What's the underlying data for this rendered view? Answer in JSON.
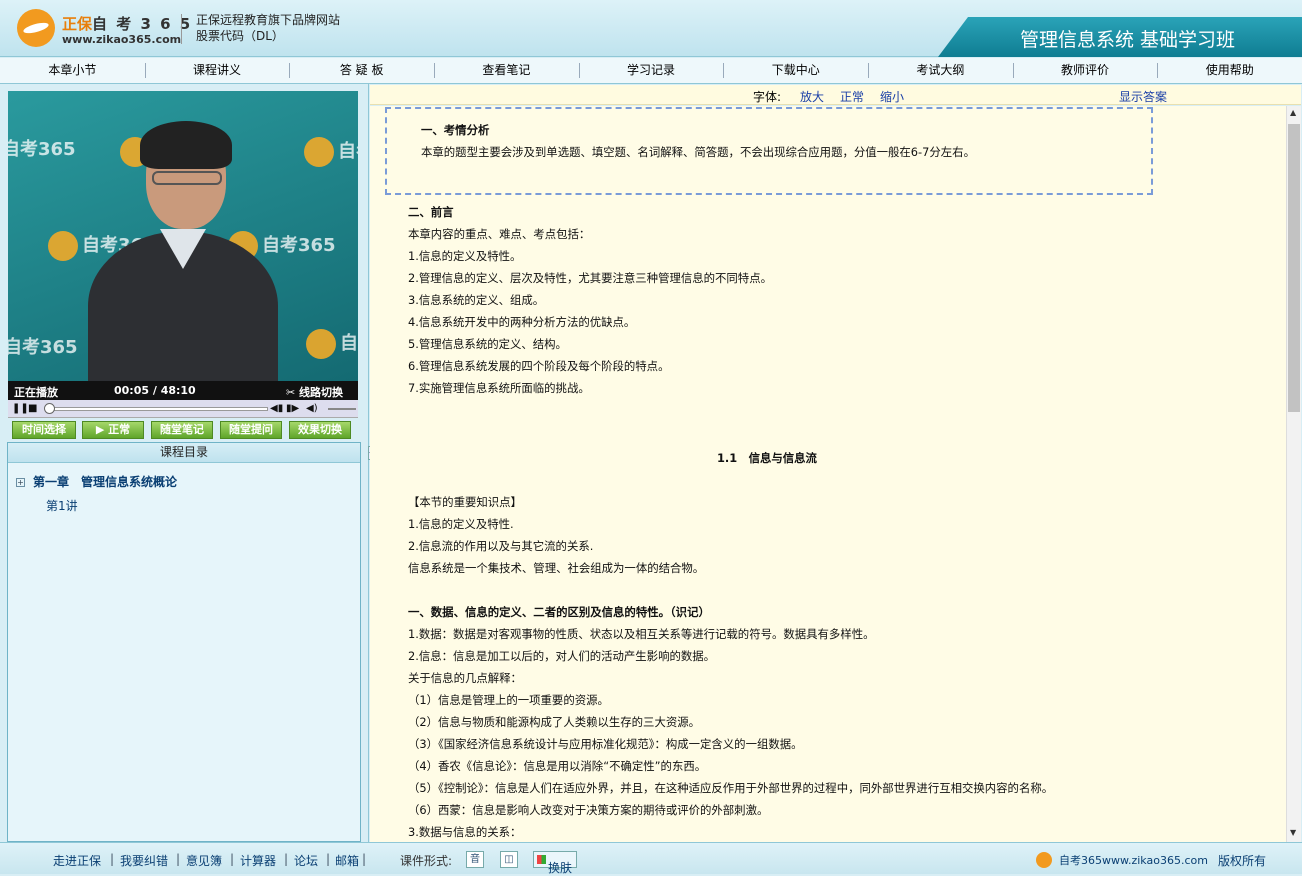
{
  "header": {
    "brand_cn": "正保",
    "brand_num": "自 考 3 6 5",
    "url": "www.zikao365.com",
    "subtitle": "正保远程教育旗下品牌网站",
    "stock": "股票代码（DL）",
    "course_title": "管理信息系统 基础学习班"
  },
  "nav": [
    "本章小节",
    "课程讲义",
    "答 疑 板",
    "查看笔记",
    "学习记录",
    "下载中心",
    "考试大纲",
    "教师评价",
    "使用帮助"
  ],
  "video": {
    "status": "正在播放",
    "time": "00:05 / 48:10",
    "switch_line": "线路切换",
    "watermark": "自考365",
    "watermark_url": "www.zikao365.com",
    "progress": 0.001
  },
  "player_buttons": [
    "时间选择",
    "▶ 正常",
    "随堂笔记",
    "随堂提问",
    "效果切换"
  ],
  "toc": {
    "header": "课程目录",
    "chapter_toggle": "+",
    "chapter": "第一章　管理信息系统概论",
    "lecture": "第1讲"
  },
  "fontbar": {
    "label": "字体:",
    "larger": "放大",
    "normal": "正常",
    "smaller": "缩小",
    "show_answer": "显示答案"
  },
  "content": {
    "analysis_title": "一、考情分析",
    "analysis_text": "本章的题型主要会涉及到单选题、填空题、名词解释、简答题，不会出现综合应用题，分值一般在6-7分左右。",
    "preface_title": "二、前言",
    "preface_intro": "本章内容的重点、难点、考点包括：",
    "preface_items": [
      "1.信息的定义及特性。",
      "2.管理信息的定义、层次及特性，尤其要注意三种管理信息的不同特点。",
      "3.信息系统的定义、组成。",
      "4.信息系统开发中的两种分析方法的优缺点。",
      "5.管理信息系统的定义、结构。",
      "6.管理信息系统发展的四个阶段及每个阶段的特点。",
      "7.实施管理信息系统所面临的挑战。"
    ],
    "section_title": "1.1　信息与信息流",
    "key_points_title": "【本节的重要知识点】",
    "key_points": [
      "1.信息的定义及特性.",
      "2.信息流的作用以及与其它流的关系.",
      "信息系统是一个集技术、管理、社会组成为一体的结合物。"
    ],
    "part1_title": "一、数据、信息的定义、二者的区别及信息的特性。（识记）",
    "part1_lines": [
      "1.数据：数据是对客观事物的性质、状态以及相互关系等进行记载的符号。数据具有多样性。",
      "2.信息：信息是加工以后的，对人们的活动产生影响的数据。",
      "关于信息的几点解释：",
      "（1）信息是管理上的一项重要的资源。",
      "（2）信息与物质和能源构成了人类赖以生存的三大资源。",
      "（3）《国家经济信息系统设计与应用标准化规范》：构成一定含义的一组数据。",
      "（4）香农《信息论》：信息是用以消除“不确定性”的东西。",
      "（5）《控制论》：信息是人们在适应外界，并且，在这种适应反作用于外部世界的过程中，同外部世界进行互相交换内容的名称。",
      "（6）西蒙：信息是影响人改变对于决策方案的期待或评价的外部刺激。",
      "3.数据与信息的关系："
    ]
  },
  "footer": {
    "links": [
      "走进正保",
      "我要纠错",
      "意见簿",
      "计算器",
      "论坛",
      "邮箱"
    ],
    "format_label": "课件形式:",
    "format_audio": "音",
    "skin": "换肤",
    "site": "自考365www.zikao365.com",
    "copyright": "版权所有"
  }
}
